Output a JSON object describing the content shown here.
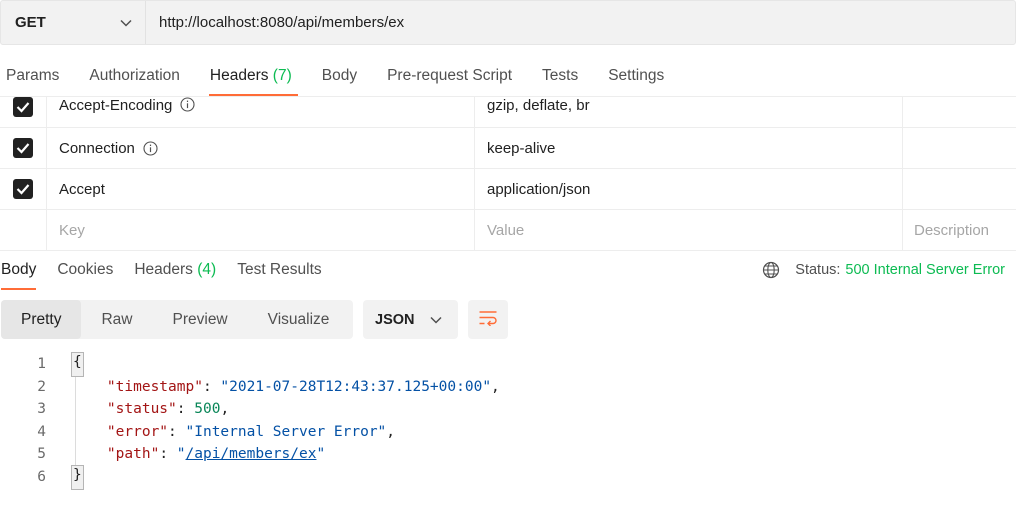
{
  "request": {
    "method": "GET",
    "url": "http://localhost:8080/api/members/ex"
  },
  "request_tabs": [
    {
      "label": "Params"
    },
    {
      "label": "Authorization"
    },
    {
      "label": "Headers",
      "count": "(7)"
    },
    {
      "label": "Body"
    },
    {
      "label": "Pre-request Script"
    },
    {
      "label": "Tests"
    },
    {
      "label": "Settings"
    }
  ],
  "headers_table": {
    "rows": [
      {
        "key": "Accept-Encoding",
        "value": "gzip, deflate, br",
        "checked": true
      },
      {
        "key": "Connection",
        "value": "keep-alive",
        "checked": true
      },
      {
        "key": "Accept",
        "value": "application/json",
        "checked": true
      }
    ],
    "placeholders": {
      "key": "Key",
      "value": "Value",
      "description": "Description"
    }
  },
  "response_tabs": [
    {
      "label": "Body"
    },
    {
      "label": "Cookies"
    },
    {
      "label": "Headers",
      "count": "(4)"
    },
    {
      "label": "Test Results"
    }
  ],
  "status": {
    "label": "Status:",
    "value": "500 Internal Server Error"
  },
  "format": {
    "buttons": [
      "Pretty",
      "Raw",
      "Preview",
      "Visualize"
    ],
    "language": "JSON"
  },
  "code": {
    "line_numbers": [
      "1",
      "2",
      "3",
      "4",
      "5",
      "6"
    ],
    "open_brace": "{",
    "close_brace": "}",
    "entries": [
      {
        "key": "\"timestamp\"",
        "value": "\"2021-07-28T12:43:37.125+00:00\"",
        "type": "string",
        "trail": ","
      },
      {
        "key": "\"status\"",
        "value": "500",
        "type": "number",
        "trail": ","
      },
      {
        "key": "\"error\"",
        "value": "\"Internal Server Error\"",
        "type": "string",
        "trail": ","
      }
    ],
    "path_key": "\"path\"",
    "path_value": "/api/members/ex"
  },
  "colors": {
    "accent": "#ff6c37",
    "success_green": "#0cbb52"
  }
}
